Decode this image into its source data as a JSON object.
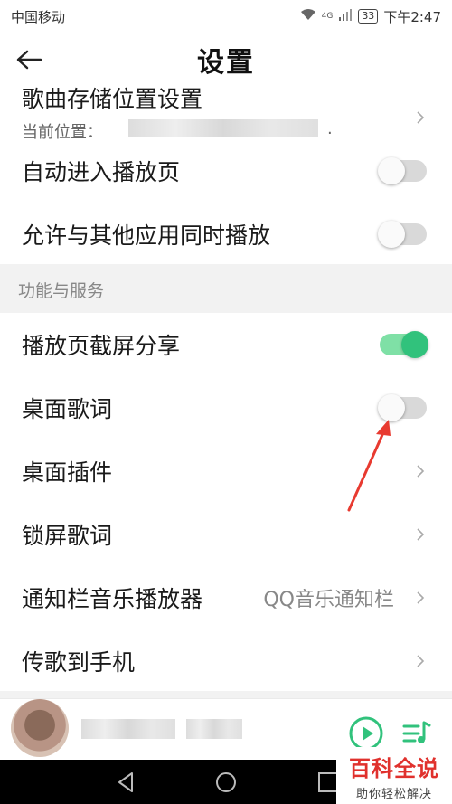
{
  "status": {
    "carrier": "中国移动",
    "network": "4G",
    "battery": "33",
    "time": "下午2:47"
  },
  "header": {
    "title": "设置"
  },
  "storage": {
    "label": "歌曲存储位置设置",
    "sub_label": "当前位置：",
    "sub_dot": "."
  },
  "toggles_top": [
    {
      "label": "自动进入播放页",
      "on": false
    },
    {
      "label": "允许与其他应用同时播放",
      "on": false
    }
  ],
  "section_services": {
    "title": "功能与服务"
  },
  "service_rows": [
    {
      "label": "播放页截屏分享",
      "type": "toggle",
      "on": true
    },
    {
      "label": "桌面歌词",
      "type": "toggle",
      "on": false
    },
    {
      "label": "桌面插件",
      "type": "link"
    },
    {
      "label": "锁屏歌词",
      "type": "link"
    },
    {
      "label": "通知栏音乐播放器",
      "type": "link",
      "value": "QQ音乐通知栏"
    },
    {
      "label": "传歌到手机",
      "type": "link"
    }
  ],
  "watermark": {
    "main": "百科全说",
    "sub": "助你轻松解决"
  },
  "colors": {
    "accent": "#31c27c",
    "arrow": "#e83a30"
  }
}
